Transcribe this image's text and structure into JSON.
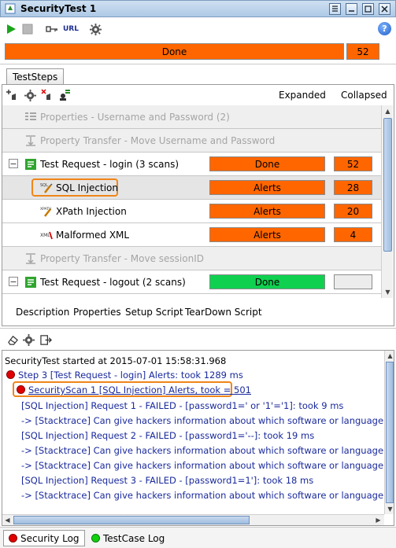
{
  "window": {
    "title": "SecurityTest 1"
  },
  "toolbar": {
    "icons": [
      "run-icon",
      "stop-icon",
      "options-icon",
      "url-icon",
      "settings-gear-icon",
      "help-icon"
    ],
    "url_label": "URL",
    "help_label": "?"
  },
  "progress": {
    "status": "Done",
    "count": "52",
    "color": "#ff6600"
  },
  "tabs": [
    "TestSteps"
  ],
  "steps_toolbar": {
    "icons": [
      "add-scan-icon",
      "configure-icon",
      "remove-scan-icon",
      "assertions-icon"
    ],
    "expanded_label": "Expanded",
    "collapsed_label": "Collapsed"
  },
  "rows": [
    {
      "label": "Properties - Username and Password (2)",
      "disabled": true
    },
    {
      "label": "Property Transfer - Move Username and Password",
      "disabled": true
    },
    {
      "label": "Test Request - login (3 scans)",
      "expander": "−",
      "status": "Done",
      "count": "52",
      "color": "#ff6600"
    },
    {
      "label": "SQL Injection",
      "status": "Alerts",
      "count": "28",
      "color": "#ff6600",
      "selected": true
    },
    {
      "label": "XPath Injection",
      "status": "Alerts",
      "count": "20",
      "color": "#ff6600"
    },
    {
      "label": "Malformed XML",
      "status": "Alerts",
      "count": "4",
      "color": "#ff6600"
    },
    {
      "label": "Property Transfer - Move sessionID",
      "disabled": true
    },
    {
      "label": "Test Request - logout (2 scans)",
      "expander": "−",
      "status": "Done",
      "count": "",
      "color": "#10d050"
    }
  ],
  "bottom_tabs": [
    "Description",
    "Properties",
    "Setup Script",
    "TearDown Script"
  ],
  "log": {
    "lines": [
      "SecurityTest started at 2015-07-01 15:58:31.968",
      "Step 3 [Test Request - login] Alerts: took 1289 ms",
      "SecurityScan 1 [SQL Injection] Alerts, took = 501",
      "[SQL Injection] Request 1 - FAILED - [password1=' or '1'='1]: took 9 ms",
      " -> [Stacktrace] Can give hackers information about which software or language you are",
      "[SQL Injection] Request 2 - FAILED - [password1='--]: took 19 ms",
      " -> [Stacktrace] Can give hackers information about which software or language you are",
      " -> [Stacktrace] Can give hackers information about which software or language you are",
      "[SQL Injection] Request 3 - FAILED - [password1=1']: took 18 ms",
      " -> [Stacktrace] Can give hackers information about which software or language you are"
    ]
  },
  "footer_tabs": [
    "Security Log",
    "TestCase Log"
  ]
}
